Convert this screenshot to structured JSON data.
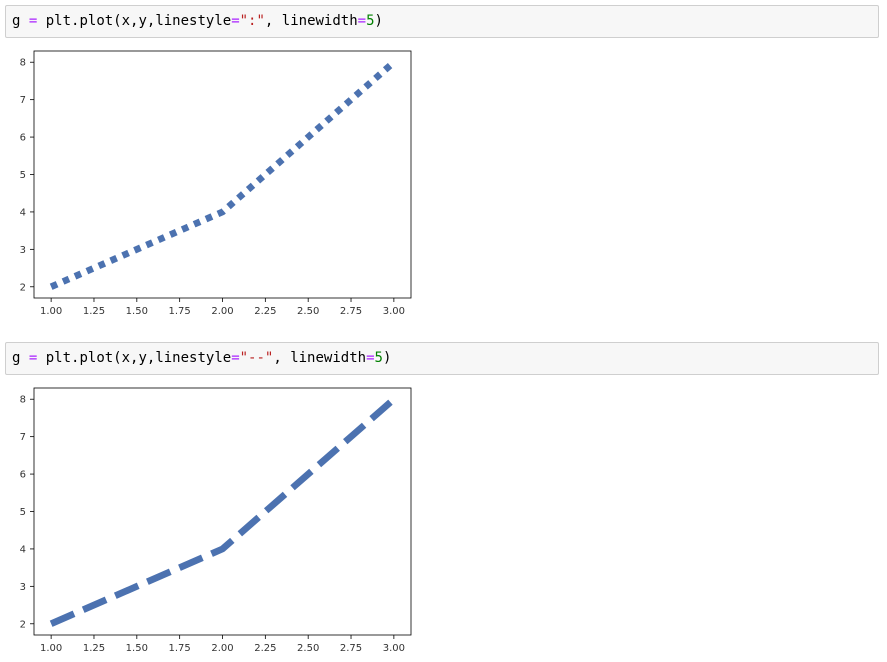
{
  "cells": [
    {
      "code": {
        "var": "g",
        "eq": "=",
        "call_open": "plt.plot(x,y,linestyle",
        "eq2": "=",
        "linestyle": "\":\"",
        "mid": ", linewidth",
        "eq3": "=",
        "linewidth": "5",
        "close": ")"
      }
    },
    {
      "code": {
        "var": "g",
        "eq": "=",
        "call_open": "plt.plot(x,y,linestyle",
        "eq2": "=",
        "linestyle": "\"--\"",
        "mid": ", linewidth",
        "eq3": "=",
        "linewidth": "5",
        "close": ")"
      }
    }
  ],
  "colors": {
    "line": "#4c72b0",
    "axes_edge": "#000000",
    "tick_text": "#333333",
    "op": "#aa22ff",
    "string": "#ba2121",
    "number": "#008000"
  },
  "chart_data": [
    {
      "type": "line",
      "linestyle": "dotted",
      "linewidth": 5,
      "x": [
        1,
        2,
        3
      ],
      "series": [
        {
          "values": [
            2,
            4,
            8
          ]
        }
      ],
      "xlim": [
        0.9,
        3.1
      ],
      "ylim": [
        1.7,
        8.3
      ],
      "xticks": [
        "1.00",
        "1.25",
        "1.50",
        "1.75",
        "2.00",
        "2.25",
        "2.50",
        "2.75",
        "3.00"
      ],
      "xtick_values": [
        1.0,
        1.25,
        1.5,
        1.75,
        2.0,
        2.25,
        2.5,
        2.75,
        3.0
      ],
      "yticks": [
        "2",
        "3",
        "4",
        "5",
        "6",
        "7",
        "8"
      ],
      "ytick_values": [
        2,
        3,
        4,
        5,
        6,
        7,
        8
      ],
      "grid": false,
      "title": "",
      "xlabel": "",
      "ylabel": ""
    },
    {
      "type": "line",
      "linestyle": "dashed",
      "linewidth": 5,
      "x": [
        1,
        2,
        3
      ],
      "series": [
        {
          "values": [
            2,
            4,
            8
          ]
        }
      ],
      "xlim": [
        0.9,
        3.1
      ],
      "ylim": [
        1.7,
        8.3
      ],
      "xticks": [
        "1.00",
        "1.25",
        "1.50",
        "1.75",
        "2.00",
        "2.25",
        "2.50",
        "2.75",
        "3.00"
      ],
      "xtick_values": [
        1.0,
        1.25,
        1.5,
        1.75,
        2.0,
        2.25,
        2.5,
        2.75,
        3.0
      ],
      "yticks": [
        "2",
        "3",
        "4",
        "5",
        "6",
        "7",
        "8"
      ],
      "ytick_values": [
        2,
        3,
        4,
        5,
        6,
        7,
        8
      ],
      "grid": false,
      "title": "",
      "xlabel": "",
      "ylabel": ""
    }
  ]
}
